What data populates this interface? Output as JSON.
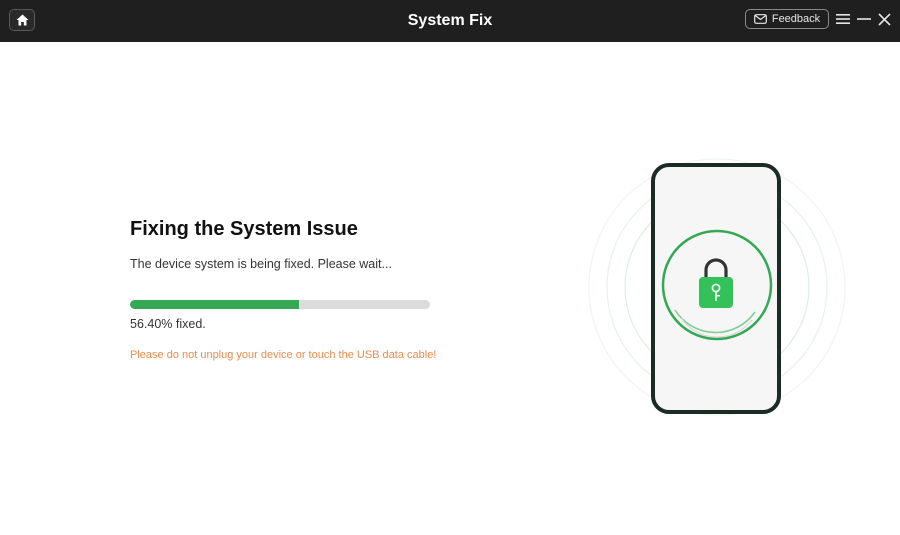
{
  "window": {
    "title": "System Fix",
    "feedback_label": "Feedback"
  },
  "icons": {
    "home": "home-icon",
    "mail": "mail-icon",
    "menu": "hamburger-menu-icon",
    "minimize": "minimize-icon",
    "close": "close-icon",
    "phone": "phone-icon",
    "lock": "lock-icon"
  },
  "main": {
    "heading": "Fixing the System Issue",
    "subtext": "The device system is being fixed. Please wait...",
    "progress_percent": 56.4,
    "progress_text": "56.40% fixed.",
    "warning": "Please do not unplug your device or touch the USB data cable!"
  },
  "colors": {
    "accent_green": "#35a853",
    "warning_orange": "#f08a4b",
    "titlebar": "#1f1f1f"
  }
}
